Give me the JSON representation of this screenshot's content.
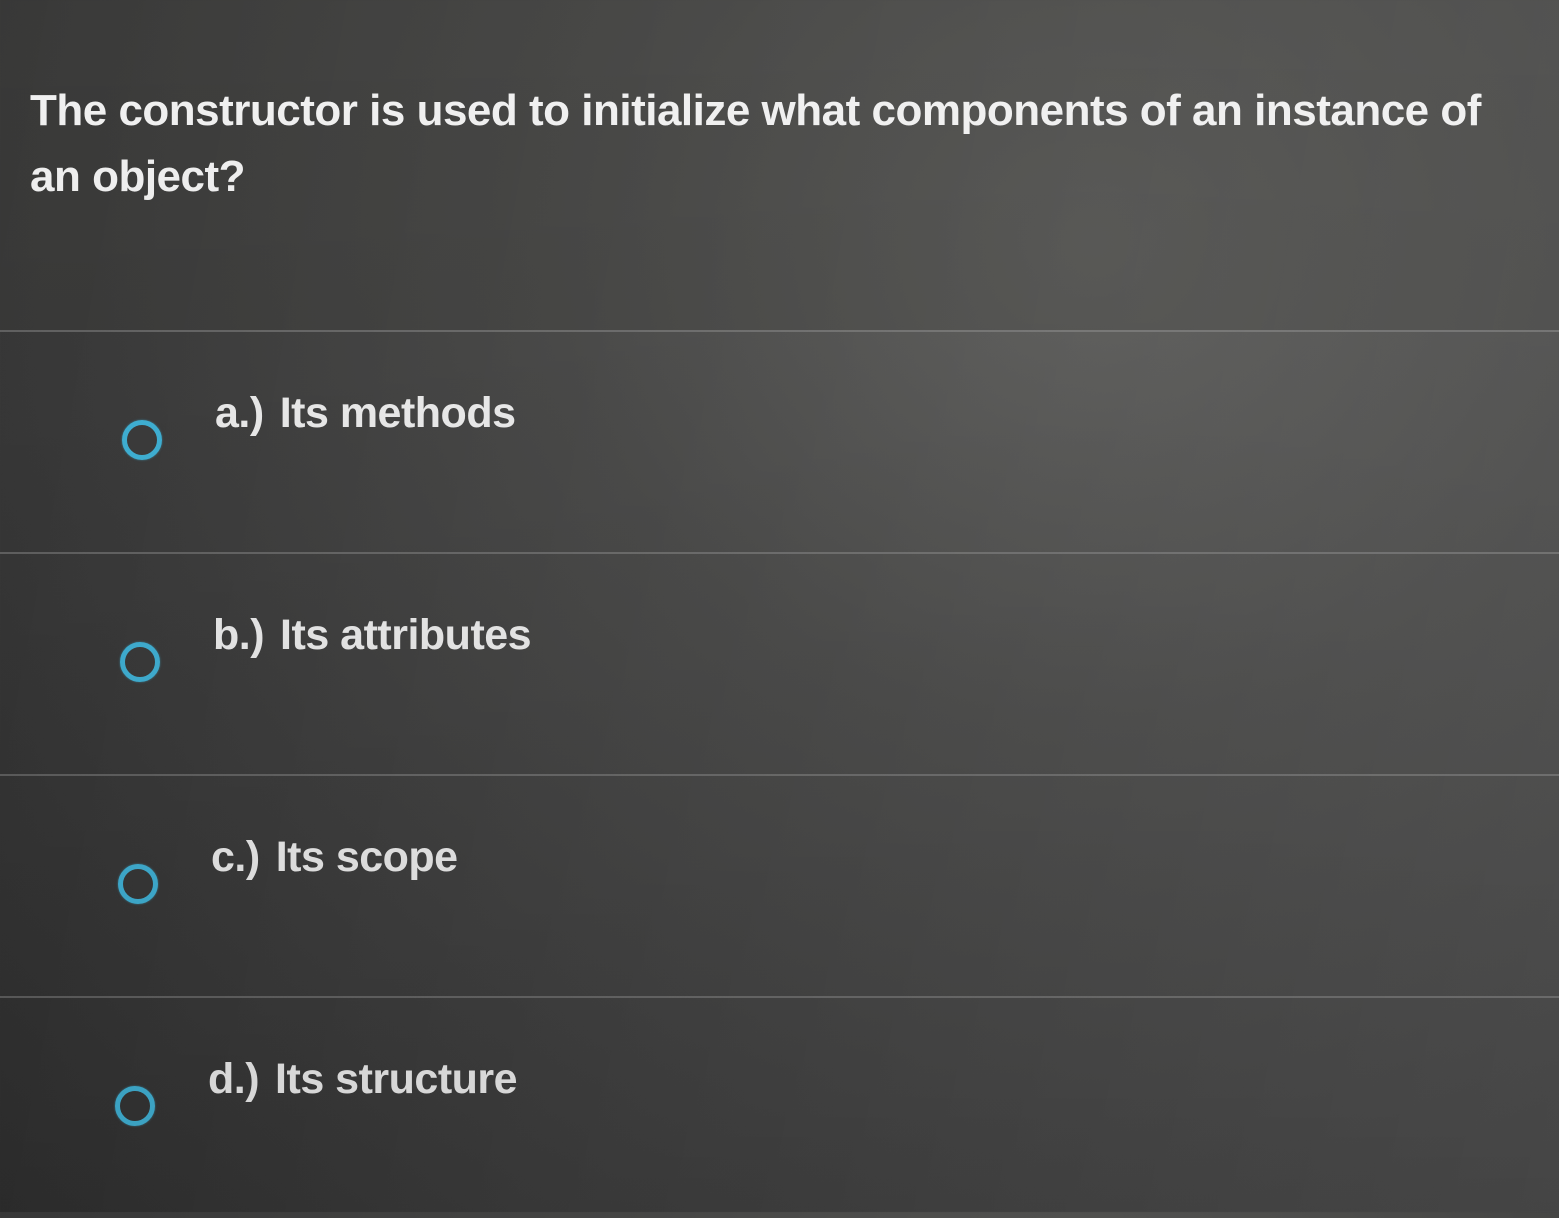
{
  "question": {
    "text": "The constructor is used to initialize what components of an instance of an object?"
  },
  "options": [
    {
      "letter": "a.)",
      "text": "Its methods",
      "selected": false
    },
    {
      "letter": "b.)",
      "text": "Its attributes",
      "selected": false
    },
    {
      "letter": "c.)",
      "text": "Its scope",
      "selected": false
    },
    {
      "letter": "d.)",
      "text": "Its structure",
      "selected": false
    }
  ],
  "colors": {
    "radio_accent": "#3fb4d9",
    "text": "#f0f0f0",
    "background": "#3a3a3a"
  }
}
